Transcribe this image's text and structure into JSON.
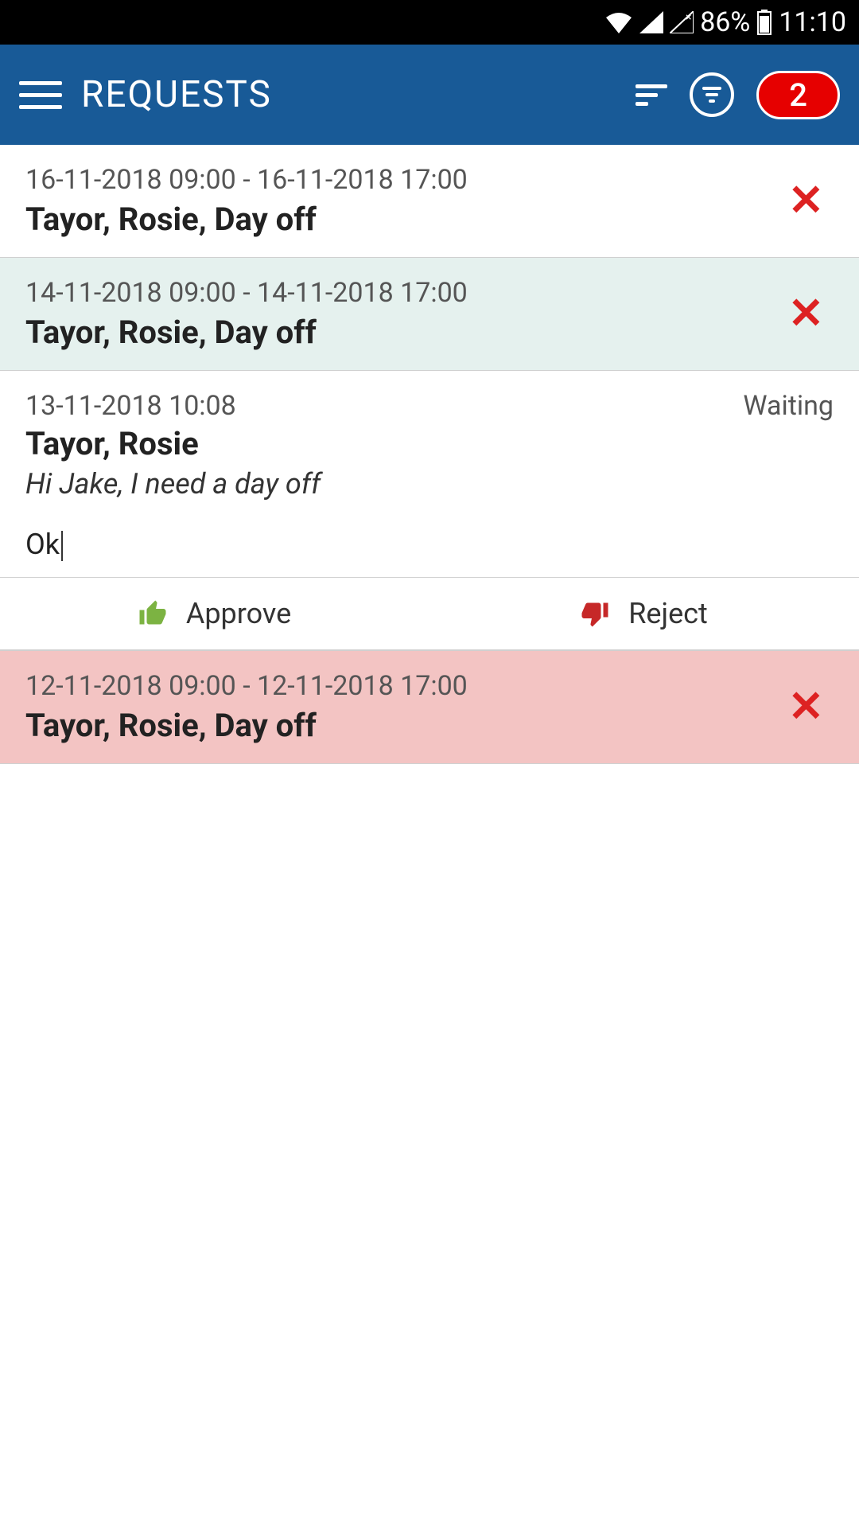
{
  "status_bar": {
    "battery_pct": "86%",
    "time": "11:10"
  },
  "app_bar": {
    "title": "REQUESTS",
    "badge_count": "2"
  },
  "requests": [
    {
      "date_range": "16-11-2018 09:00 - 16-11-2018 17:00",
      "title": "Tayor, Rosie, Day off"
    },
    {
      "date_range": "14-11-2018 09:00 - 14-11-2018 17:00",
      "title": "Tayor, Rosie, Day off"
    },
    {
      "date_range": "12-11-2018 09:00 - 12-11-2018 17:00",
      "title": "Tayor, Rosie, Day off"
    }
  ],
  "expanded": {
    "timestamp": "13-11-2018 10:08",
    "status": "Waiting",
    "name": "Tayor, Rosie",
    "message": "Hi Jake, I need a day off",
    "reply": "Ok"
  },
  "actions": {
    "approve": "Approve",
    "reject": "Reject"
  }
}
